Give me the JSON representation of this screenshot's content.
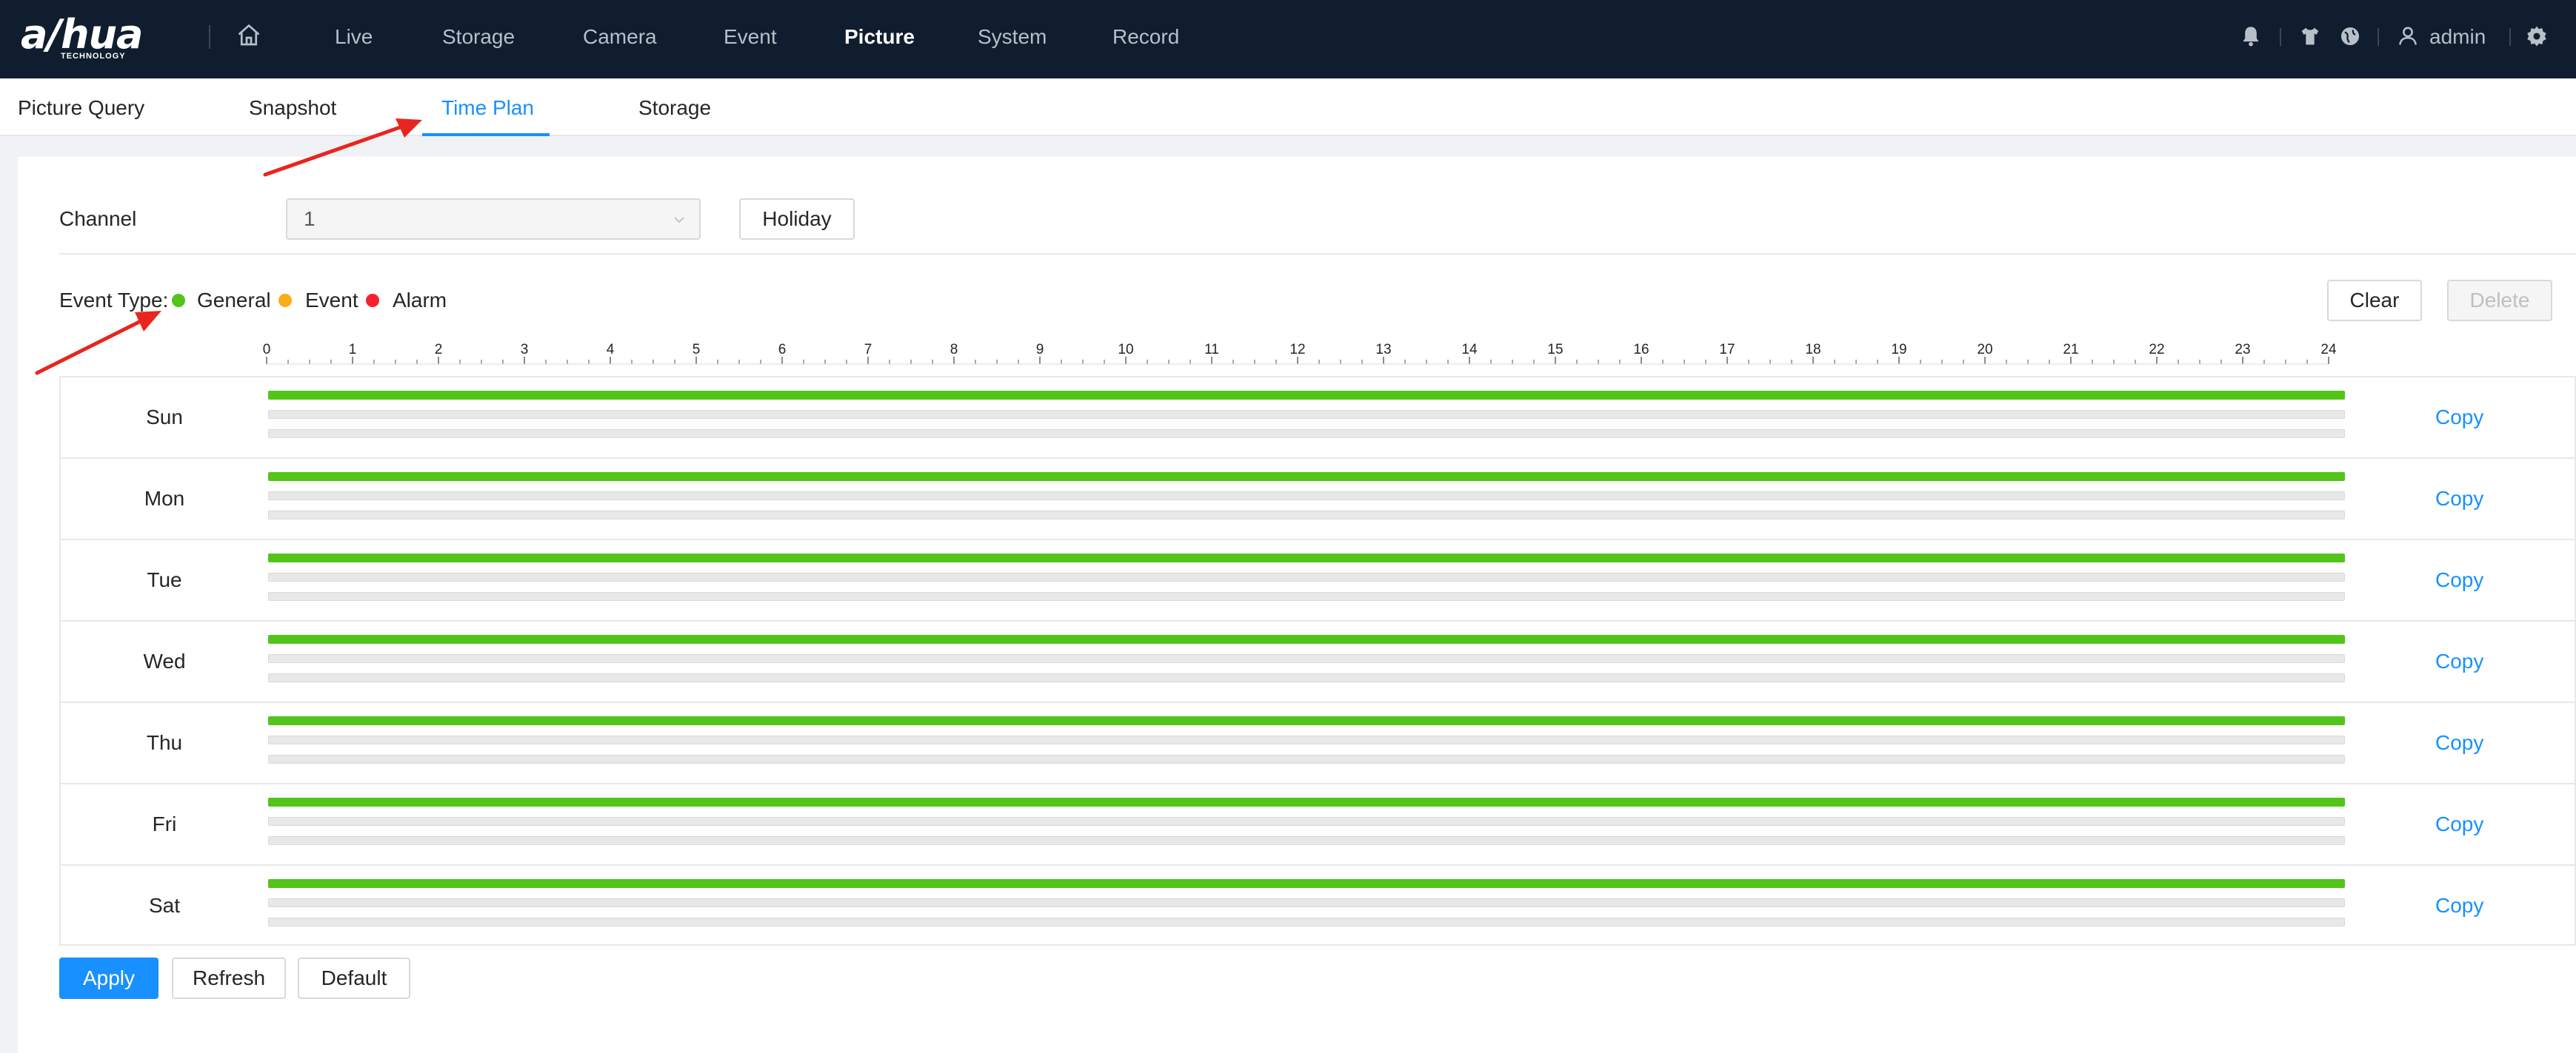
{
  "brand": {
    "logo_text": "a/hua",
    "logo_sub": "TECHNOLOGY"
  },
  "nav": {
    "items": [
      {
        "label": "Live",
        "active": false
      },
      {
        "label": "Storage",
        "active": false
      },
      {
        "label": "Camera",
        "active": false
      },
      {
        "label": "Event",
        "active": false
      },
      {
        "label": "Picture",
        "active": true
      },
      {
        "label": "System",
        "active": false
      },
      {
        "label": "Record",
        "active": false
      }
    ],
    "user": "admin",
    "icons": [
      "home-icon",
      "bell-icon",
      "shirt-icon",
      "globe-icon",
      "user-icon",
      "gear-icon"
    ]
  },
  "subtabs": [
    {
      "label": "Picture Query",
      "active": false
    },
    {
      "label": "Snapshot",
      "active": false
    },
    {
      "label": "Time Plan",
      "active": true
    },
    {
      "label": "Storage",
      "active": false
    }
  ],
  "form": {
    "channel_label": "Channel",
    "channel_value": "1",
    "holiday_button": "Holiday",
    "event_type_label": "Event Type:",
    "legend": [
      {
        "label": "General",
        "color": "#52c41a"
      },
      {
        "label": "Event",
        "color": "#faad14"
      },
      {
        "label": "Alarm",
        "color": "#f5222d"
      }
    ],
    "clear_button": "Clear",
    "delete_button": "Delete"
  },
  "ruler": {
    "hours": [
      "0",
      "1",
      "2",
      "3",
      "4",
      "5",
      "6",
      "7",
      "8",
      "9",
      "10",
      "11",
      "12",
      "13",
      "14",
      "15",
      "16",
      "17",
      "18",
      "19",
      "20",
      "21",
      "22",
      "23",
      "24"
    ]
  },
  "schedule": {
    "copy_label": "Copy",
    "days": [
      {
        "day": "Sun",
        "general": [
          0,
          24
        ]
      },
      {
        "day": "Mon",
        "general": [
          0,
          24
        ]
      },
      {
        "day": "Tue",
        "general": [
          0,
          24
        ]
      },
      {
        "day": "Wed",
        "general": [
          0,
          24
        ]
      },
      {
        "day": "Thu",
        "general": [
          0,
          24
        ]
      },
      {
        "day": "Fri",
        "general": [
          0,
          24
        ]
      },
      {
        "day": "Sat",
        "general": [
          0,
          24
        ]
      }
    ]
  },
  "actions": {
    "apply": "Apply",
    "refresh": "Refresh",
    "default": "Default"
  }
}
